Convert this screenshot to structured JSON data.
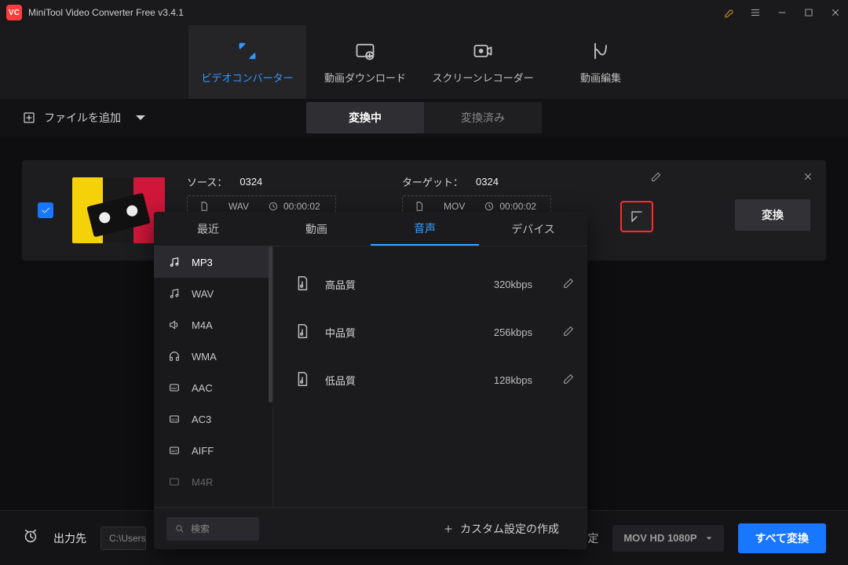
{
  "app": {
    "title": "MiniTool Video Converter Free v3.4.1",
    "logo_text": "VC"
  },
  "main_tabs": {
    "video_converter": "ビデオコンバーター",
    "video_download": "動画ダウンロード",
    "screen_recorder": "スクリーンレコーダー",
    "video_edit": "動画編集"
  },
  "toolbar": {
    "add_file": "ファイルを追加",
    "center_tabs": {
      "converting": "変換中",
      "converted": "変換済み"
    }
  },
  "card": {
    "source_label": "ソース：",
    "source_name": "0324",
    "source_format": "WAV",
    "source_duration": "00:00:02",
    "target_label": "ターゲット：",
    "target_name": "0324",
    "target_format": "MOV",
    "target_duration": "00:00:02",
    "convert_btn": "変換"
  },
  "popover": {
    "tabs": {
      "recent": "最近",
      "video": "動画",
      "audio": "音声",
      "device": "デバイス"
    },
    "formats": [
      "MP3",
      "WAV",
      "M4A",
      "WMA",
      "AAC",
      "AC3",
      "AIFF",
      "M4R"
    ],
    "qualities": [
      {
        "label": "高品質",
        "bitrate": "320kbps"
      },
      {
        "label": "中品質",
        "bitrate": "256kbps"
      },
      {
        "label": "低品質",
        "bitrate": "128kbps"
      }
    ],
    "search_placeholder": "検索",
    "custom_create": "カスタム設定の作成"
  },
  "bottom": {
    "output_label": "出力先",
    "output_path": "C:\\Users",
    "output_set_suffix": "定",
    "format_select": "MOV HD 1080P",
    "convert_all": "すべて変換"
  }
}
